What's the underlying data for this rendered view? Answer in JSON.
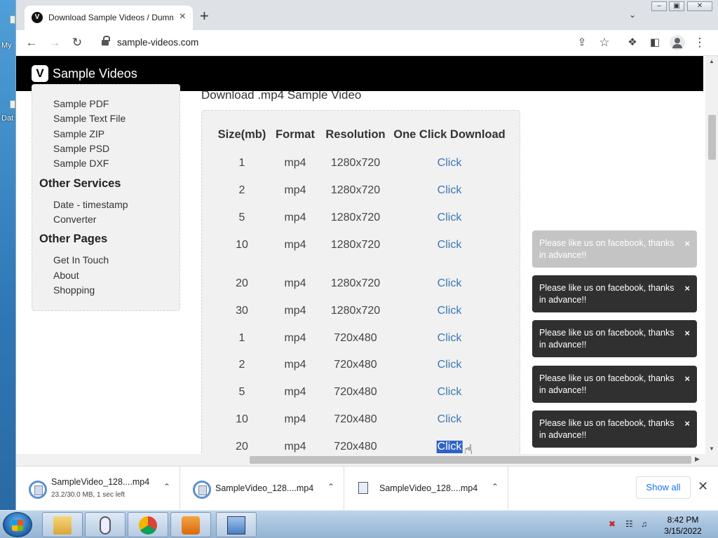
{
  "desktop": {
    "icon_labels": [
      "My",
      "Dat"
    ]
  },
  "browser": {
    "tab": {
      "title": "Download Sample Videos / Dummy Videos For Demo Use",
      "favicon": "V"
    },
    "address": {
      "url": "sample-videos.com"
    }
  },
  "site": {
    "logo_letter": "V",
    "title": "Sample Videos",
    "sidebar": {
      "links_top": [
        "Sample PDF",
        "Sample Text File",
        "Sample ZIP",
        "Sample PSD",
        "Sample DXF"
      ],
      "other_services": {
        "heading": "Other Services",
        "links": [
          "Date - timestamp",
          "Converter"
        ]
      },
      "other_pages": {
        "heading": "Other Pages",
        "links": [
          "Get In Touch",
          "About",
          "Shopping"
        ]
      }
    },
    "heading": "Download .mp4 Sample Video",
    "table": {
      "columns": [
        "Size(mb)",
        "Format",
        "Resolution",
        "One Click Download"
      ],
      "rows": [
        [
          "1",
          "mp4",
          "1280x720",
          "Click"
        ],
        [
          "2",
          "mp4",
          "1280x720",
          "Click"
        ],
        [
          "5",
          "mp4",
          "1280x720",
          "Click"
        ],
        [
          "10",
          "mp4",
          "1280x720",
          "Click"
        ],
        [
          "20",
          "mp4",
          "1280x720",
          "Click"
        ],
        [
          "30",
          "mp4",
          "1280x720",
          "Click"
        ],
        [
          "1",
          "mp4",
          "720x480",
          "Click"
        ],
        [
          "2",
          "mp4",
          "720x480",
          "Click"
        ],
        [
          "5",
          "mp4",
          "720x480",
          "Click"
        ],
        [
          "10",
          "mp4",
          "720x480",
          "Click"
        ],
        [
          "20",
          "mp4",
          "720x480",
          "Click"
        ]
      ]
    },
    "toasts": [
      "Please like us on facebook, thanks in advance!!",
      "Please like us on facebook, thanks in advance!!",
      "Please like us on facebook, thanks in advance!!",
      "Please like us on facebook, thanks in advance!!",
      "Please like us on facebook, thanks in advance!!"
    ],
    "toast_close": "×"
  },
  "downloads": {
    "items": [
      {
        "name": "SampleVideo_128....mp4",
        "meta": "23.2/30.0 MB, 1 sec left",
        "icon": "progress-icon"
      },
      {
        "name": "SampleVideo_128....mp4",
        "meta": "",
        "icon": "progress-icon"
      },
      {
        "name": "SampleVideo_128....mp4",
        "meta": "",
        "icon": "file-icon"
      }
    ],
    "show_all": "Show all"
  },
  "taskbar": {
    "time": "8:42 PM",
    "date": "3/15/2022"
  },
  "colors": {
    "link": "#3a76b6",
    "selection": "#2e63c6",
    "toast_bg": "#303030",
    "header_bg": "#000000"
  }
}
